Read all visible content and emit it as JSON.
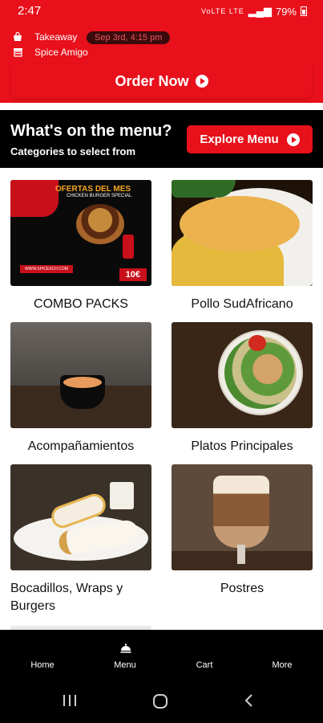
{
  "status_bar": {
    "time": "2:47",
    "network": "VoLTE LTE",
    "battery": "79%"
  },
  "header": {
    "order_type": "Takeaway",
    "order_time": "Sep 3rd, 4:15 pm",
    "restaurant": "Spice Amigo",
    "order_button": "Order Now"
  },
  "menu_banner": {
    "title": "What's on the menu?",
    "subtitle": "Categories to select from",
    "explore_button": "Explore Menu"
  },
  "categories": [
    {
      "label": "COMBO PACKS"
    },
    {
      "label": "Pollo SudAfricano"
    },
    {
      "label": "Acompañamientos"
    },
    {
      "label": "Platos Principales"
    },
    {
      "label": "Bocadillos, Wraps y Burgers"
    },
    {
      "label": "Postres"
    }
  ],
  "combo_art": {
    "headline": "OFERTAS DEL MES",
    "subline": "CHICKEN BURGER SPECIAL",
    "price": "10€",
    "url": "WWW.SPICESCH.COM"
  },
  "bottom_nav": [
    {
      "label": "Home"
    },
    {
      "label": "Menu"
    },
    {
      "label": "Cart"
    },
    {
      "label": "More"
    }
  ],
  "colors": {
    "brand_red": "#e8101b",
    "black": "#000000"
  }
}
